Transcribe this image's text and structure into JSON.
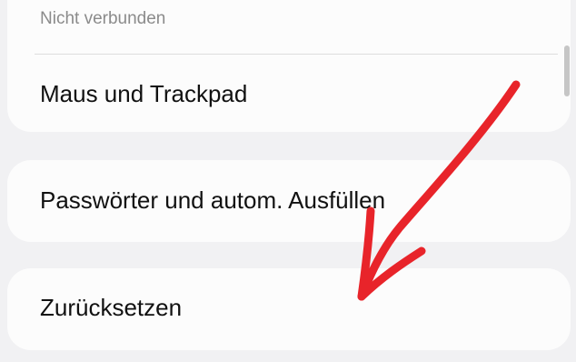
{
  "settings": {
    "status_text": "Nicht verbunden",
    "items": [
      {
        "label": "Maus und Trackpad"
      },
      {
        "label": "Passwörter und autom. Ausfüllen"
      },
      {
        "label": "Zurücksetzen"
      }
    ]
  },
  "annotation": {
    "arrow_color": "#e8242a"
  }
}
